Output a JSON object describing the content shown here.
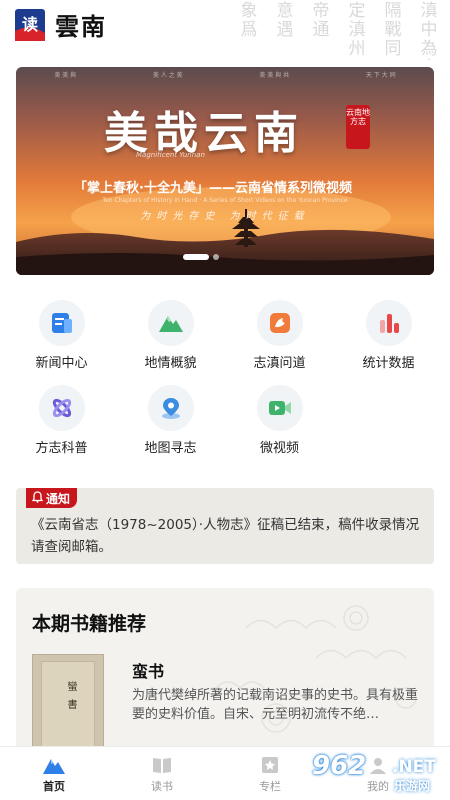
{
  "header": {
    "brand": "雲南",
    "logo_glyph": "读",
    "watermark_columns": [
      "滇中為方志",
      "隔戰同",
      "定滇州",
      "帝通",
      "意遇",
      "象爲"
    ]
  },
  "banner": {
    "top_strip": [
      "美 美 與",
      "美 人 之 美",
      "美 美 與 共",
      "天 下 大 同"
    ],
    "title": "美哉云南",
    "seal_text": "云南地方志",
    "english_title": "Magnificent Yunnan",
    "subtitle": "「掌上春秋·十全九美」——云南省情系列微视频",
    "english_subtitle": "Ten Chapters of History in Hand · A Series of Short Videos on the Yunnan Province",
    "tagline": "为时光存史   为时代征载",
    "slide_count": 3,
    "active_slide": 0
  },
  "grid": [
    {
      "label": "新闻中心",
      "icon": "news-icon",
      "color": "#2f7fe8"
    },
    {
      "label": "地情概貌",
      "icon": "mountain-icon",
      "color": "#3fb36b"
    },
    {
      "label": "志滇问道",
      "icon": "bird-icon",
      "color": "#f07b3a"
    },
    {
      "label": "统计数据",
      "icon": "bar-chart-icon",
      "color": "#e8484a"
    },
    {
      "label": "方志科普",
      "icon": "atom-icon",
      "color": "#6a5bd9"
    },
    {
      "label": "地图寻志",
      "icon": "map-pin-icon",
      "color": "#3a8de0"
    },
    {
      "label": "微视频",
      "icon": "video-icon",
      "color": "#3fb36b"
    }
  ],
  "notice": {
    "tag": "通知",
    "text": "《云南省志（1978~2005）·人物志》征稿已结束，稿件收录情况请查阅邮箱。"
  },
  "books": {
    "section_title": "本期书籍推荐",
    "book_name": "蛮书",
    "cover_title": "蠻書",
    "description": "为唐代樊绰所著的记载南诏史事的史书。具有极重要的史料价值。自宋、元至明初流传不绝…"
  },
  "tabbar": [
    {
      "label": "首页",
      "icon": "home-mountain-icon",
      "active": true
    },
    {
      "label": "读书",
      "icon": "book-icon",
      "active": false
    },
    {
      "label": "专栏",
      "icon": "column-icon",
      "active": false
    },
    {
      "label": "我的",
      "icon": "user-icon",
      "active": false
    }
  ],
  "overlay_watermark": {
    "number": "962",
    "suffix": ".NET",
    "caption": "乐游网"
  }
}
